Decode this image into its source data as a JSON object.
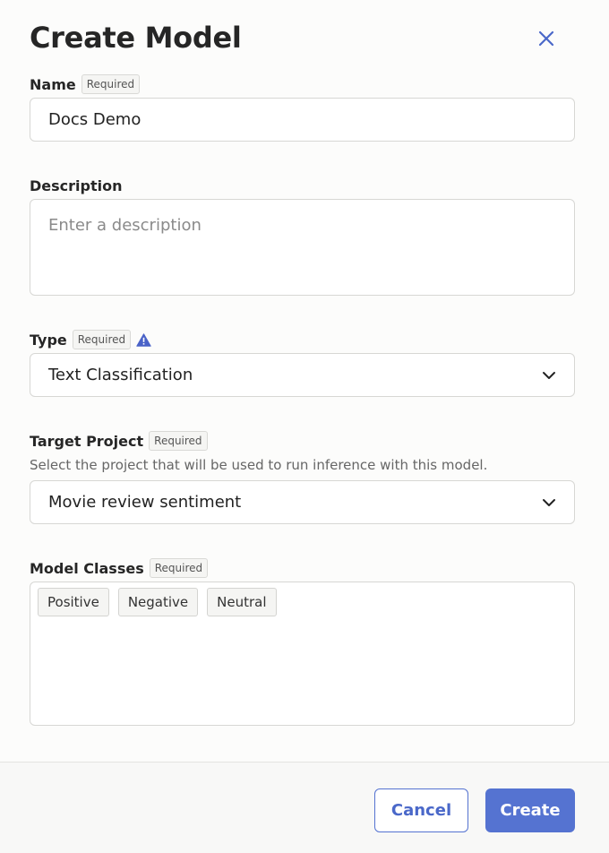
{
  "dialog": {
    "title": "Create Model",
    "close_icon": "close-icon"
  },
  "required_badge": "Required",
  "fields": {
    "name": {
      "label": "Name",
      "value": "Docs Demo"
    },
    "description": {
      "label": "Description",
      "placeholder": "Enter a description",
      "value": ""
    },
    "type": {
      "label": "Type",
      "value": "Text Classification",
      "warning_icon": "warning-triangle-icon"
    },
    "target_project": {
      "label": "Target Project",
      "helper": "Select the project that will be used to run inference with this model.",
      "value": "Movie review sentiment"
    },
    "model_classes": {
      "label": "Model Classes",
      "tags": [
        "Positive",
        "Negative",
        "Neutral"
      ]
    }
  },
  "footer": {
    "cancel_label": "Cancel",
    "create_label": "Create"
  },
  "colors": {
    "accent": "#5573d1",
    "warning": "#4a63c8"
  }
}
